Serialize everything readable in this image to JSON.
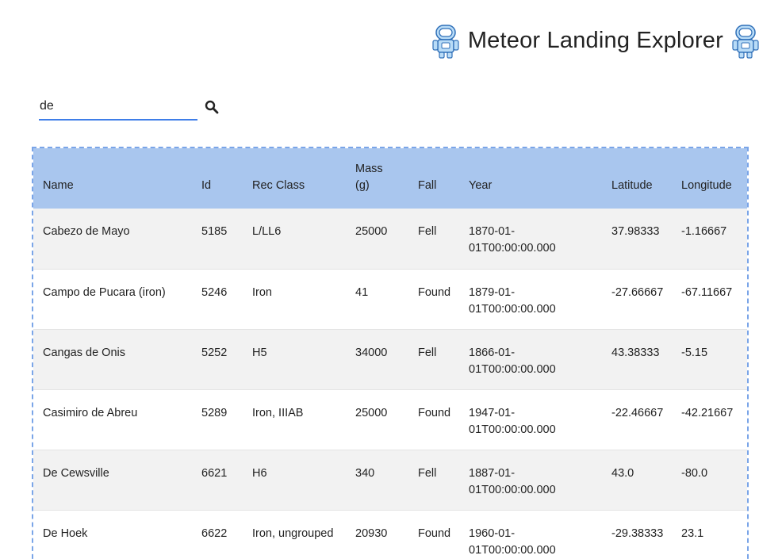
{
  "header": {
    "title": "Meteor Landing Explorer",
    "left_icon": "astronaut-robot-icon",
    "right_icon": "astronaut-robot-icon"
  },
  "search": {
    "value": "de",
    "placeholder": "",
    "button_icon": "search-icon"
  },
  "colors": {
    "accent": "#3f7ee8",
    "table_header_bg": "#a9c6ee",
    "table_border": "#7aa5e8",
    "row_alt_bg": "#f2f2f2"
  },
  "table": {
    "columns": [
      "Name",
      "Id",
      "Rec Class",
      "Mass (g)",
      "Fall",
      "Year",
      "Latitude",
      "Longitude"
    ],
    "rows": [
      [
        "Cabezo de Mayo",
        "5185",
        "L/LL6",
        "25000",
        "Fell",
        "1870-01-01T00:00:00.000",
        "37.98333",
        "-1.16667"
      ],
      [
        "Campo de Pucara (iron)",
        "5246",
        "Iron",
        "41",
        "Found",
        "1879-01-01T00:00:00.000",
        "-27.66667",
        "-67.11667"
      ],
      [
        "Cangas de Onis",
        "5252",
        "H5",
        "34000",
        "Fell",
        "1866-01-01T00:00:00.000",
        "43.38333",
        "-5.15"
      ],
      [
        "Casimiro de Abreu",
        "5289",
        "Iron, IIIAB",
        "25000",
        "Found",
        "1947-01-01T00:00:00.000",
        "-22.46667",
        "-42.21667"
      ],
      [
        "De Cewsville",
        "6621",
        "H6",
        "340",
        "Fell",
        "1887-01-01T00:00:00.000",
        "43.0",
        "-80.0"
      ],
      [
        "De Hoek",
        "6622",
        "Iron, ungrouped",
        "20930",
        "Found",
        "1960-01-01T00:00:00.000",
        "-29.38333",
        "23.1"
      ]
    ]
  }
}
